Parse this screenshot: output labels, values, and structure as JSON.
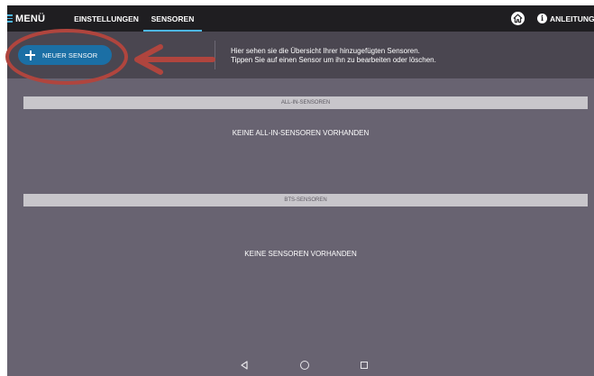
{
  "topbar": {
    "menu_label": "MENÜ",
    "tabs": [
      {
        "label": "EINSTELLUNGEN",
        "active": false
      },
      {
        "label": "SENSOREN",
        "active": true
      }
    ],
    "home_icon": "home-icon",
    "info_icon": "info-icon",
    "info_glyph": "i",
    "anleitung_label": "ANLEITUNG"
  },
  "header": {
    "new_sensor_label": "NEUER SENSOR",
    "description_line1": "Hier sehen sie die Übersicht Ihrer hinzugefügten Sensoren.",
    "description_line2": "Tippen Sie auf einen Sensor um ihn zu bearbeiten oder löschen."
  },
  "sections": {
    "allin": {
      "header": "ALL-IN-SENSOREN",
      "empty_text": "KEINE ALL-IN-SENSOREN VORHANDEN"
    },
    "bts": {
      "header": "BTS-SENSOREN",
      "empty_text": "KEINE SENSOREN VORHANDEN"
    }
  },
  "nav": {
    "icons": [
      "back-icon",
      "home-circle-icon",
      "recents-icon"
    ]
  },
  "colors": {
    "accent": "#4db6e6",
    "button": "#1b6fa5",
    "background": "#686371",
    "topbar": "#1f1e21",
    "header": "#4a4650",
    "annotation": "#b0453e"
  }
}
